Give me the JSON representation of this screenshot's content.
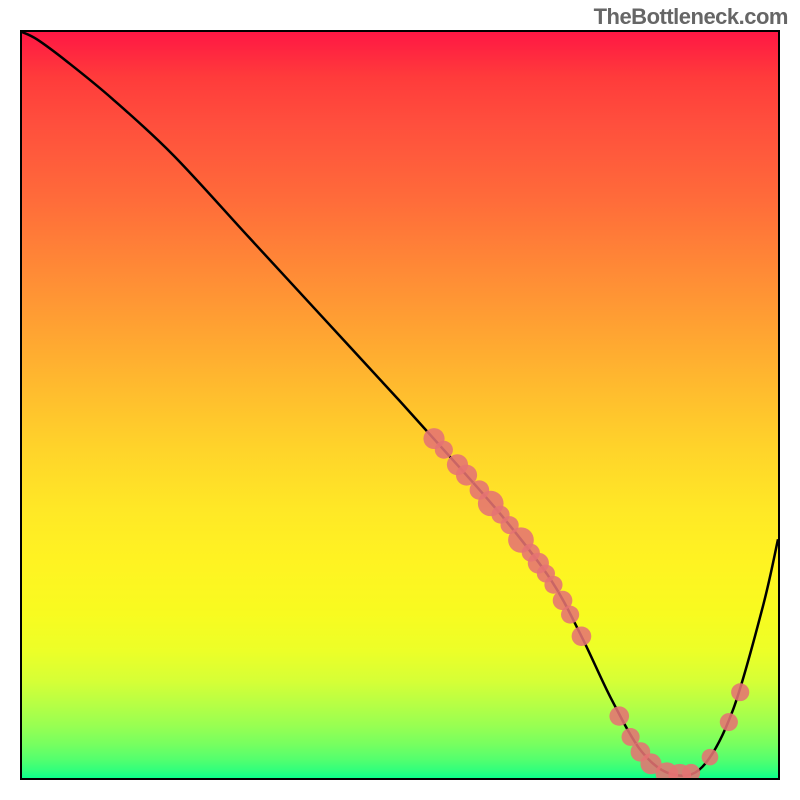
{
  "watermark": "TheBottleneck.com",
  "chart_data": {
    "type": "line",
    "title": "",
    "xlabel": "",
    "ylabel": "",
    "xlim": [
      0,
      100
    ],
    "ylim": [
      0,
      100
    ],
    "grid": false,
    "series": [
      {
        "name": "curve",
        "x": [
          0,
          2,
          6,
          12,
          20,
          30,
          40,
          50,
          58,
          64,
          70,
          74,
          78,
          82,
          86,
          90,
          94,
          98,
          100
        ],
        "values": [
          100,
          99,
          96,
          91,
          83.5,
          72.5,
          61.5,
          50.5,
          41.5,
          34.5,
          26.5,
          19,
          10.5,
          3.5,
          0.5,
          1.5,
          9,
          23,
          32
        ],
        "color": "#000000"
      }
    ],
    "markers": [
      {
        "x": 54.5,
        "y": 45.5,
        "r": 1.4
      },
      {
        "x": 55.8,
        "y": 44.0,
        "r": 1.2
      },
      {
        "x": 57.6,
        "y": 42.0,
        "r": 1.4
      },
      {
        "x": 58.8,
        "y": 40.6,
        "r": 1.4
      },
      {
        "x": 60.5,
        "y": 38.6,
        "r": 1.3
      },
      {
        "x": 62.0,
        "y": 36.8,
        "r": 1.7
      },
      {
        "x": 63.3,
        "y": 35.3,
        "r": 1.2
      },
      {
        "x": 64.5,
        "y": 33.9,
        "r": 1.2
      },
      {
        "x": 66.0,
        "y": 31.9,
        "r": 1.7
      },
      {
        "x": 67.3,
        "y": 30.2,
        "r": 1.2
      },
      {
        "x": 68.3,
        "y": 28.8,
        "r": 1.4
      },
      {
        "x": 69.3,
        "y": 27.4,
        "r": 1.2
      },
      {
        "x": 70.3,
        "y": 25.9,
        "r": 1.2
      },
      {
        "x": 71.5,
        "y": 23.8,
        "r": 1.3
      },
      {
        "x": 72.5,
        "y": 21.9,
        "r": 1.2
      },
      {
        "x": 74.0,
        "y": 19.0,
        "r": 1.3
      },
      {
        "x": 79.0,
        "y": 8.3,
        "r": 1.3
      },
      {
        "x": 80.5,
        "y": 5.5,
        "r": 1.2
      },
      {
        "x": 81.8,
        "y": 3.5,
        "r": 1.3
      },
      {
        "x": 83.2,
        "y": 1.9,
        "r": 1.4
      },
      {
        "x": 85.3,
        "y": 0.6,
        "r": 1.5
      },
      {
        "x": 87.0,
        "y": 0.4,
        "r": 1.5
      },
      {
        "x": 88.5,
        "y": 0.7,
        "r": 1.2
      },
      {
        "x": 91.0,
        "y": 2.8,
        "r": 1.1
      },
      {
        "x": 93.5,
        "y": 7.5,
        "r": 1.2
      },
      {
        "x": 95.0,
        "y": 11.5,
        "r": 1.2
      }
    ],
    "marker_color": "#e57373"
  }
}
